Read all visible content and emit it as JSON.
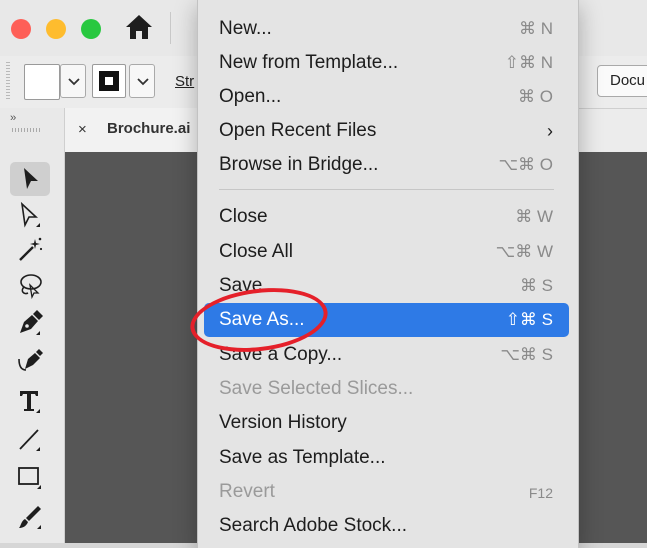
{
  "controlbar": {
    "stroke_label": "Str",
    "document_button": "Docu"
  },
  "document": {
    "close_glyph": "×",
    "tab_title": "Brochure.ai"
  },
  "panel": {
    "collapse_glyph": "››"
  },
  "menu": {
    "items": [
      {
        "label": "New...",
        "shortcut": "⌘ N"
      },
      {
        "label": "New from Template...",
        "shortcut": "⇧⌘ N"
      },
      {
        "label": "Open...",
        "shortcut": "⌘ O"
      },
      {
        "label": "Open Recent Files",
        "shortcut": "›"
      },
      {
        "label": "Browse in Bridge...",
        "shortcut": "⌥⌘ O"
      },
      {
        "label": "Close",
        "shortcut": "⌘ W"
      },
      {
        "label": "Close All",
        "shortcut": "⌥⌘ W"
      },
      {
        "label": "Save",
        "shortcut": "⌘ S"
      },
      {
        "label": "Save As...",
        "shortcut": "⇧⌘ S"
      },
      {
        "label": "Save a Copy...",
        "shortcut": "⌥⌘ S"
      },
      {
        "label": "Save Selected Slices...",
        "shortcut": ""
      },
      {
        "label": "Version History",
        "shortcut": ""
      },
      {
        "label": "Save as Template...",
        "shortcut": ""
      },
      {
        "label": "Revert",
        "shortcut": "F12"
      },
      {
        "label": "Search Adobe Stock...",
        "shortcut": ""
      }
    ],
    "highlighted": "Save As...",
    "disabled": [
      "Save Selected Slices...",
      "Revert"
    ]
  },
  "colors": {
    "highlight": "#2e7ae6",
    "annotation_circle": "#e5202a",
    "traffic_red": "#fe5f57",
    "traffic_yellow": "#febc2e",
    "traffic_green": "#28c840"
  },
  "icons": [
    "home-icon",
    "selection-tool-icon",
    "direct-selection-tool-icon",
    "magic-wand-tool-icon",
    "lasso-tool-icon",
    "pen-tool-icon",
    "curvature-tool-icon",
    "type-tool-icon",
    "line-segment-tool-icon",
    "rectangle-tool-icon",
    "paintbrush-tool-icon"
  ]
}
